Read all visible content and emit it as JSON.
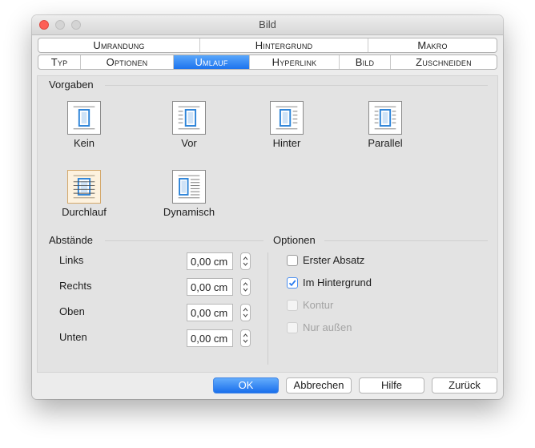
{
  "window": {
    "title": "Bild"
  },
  "tabs": {
    "row1": [
      "Umrandung",
      "Hintergrund",
      "Makro"
    ],
    "row2": [
      "Typ",
      "Optionen",
      "Umlauf",
      "Hyperlink",
      "Bild",
      "Zuschneiden"
    ],
    "active": "Umlauf"
  },
  "vorgaben": {
    "title": "Vorgaben",
    "items": [
      {
        "label": "Kein",
        "icon": "wrap-none-icon",
        "selected": false
      },
      {
        "label": "Vor",
        "icon": "wrap-before-icon",
        "selected": false
      },
      {
        "label": "Hinter",
        "icon": "wrap-after-icon",
        "selected": false
      },
      {
        "label": "Parallel",
        "icon": "wrap-parallel-icon",
        "selected": false
      },
      {
        "label": "Durchlauf",
        "icon": "wrap-through-icon",
        "selected": true
      },
      {
        "label": "Dynamisch",
        "icon": "wrap-optimal-icon",
        "selected": false
      }
    ]
  },
  "abstaende": {
    "title": "Abstände",
    "rows": [
      {
        "label": "Links",
        "value": "0,00 cm"
      },
      {
        "label": "Rechts",
        "value": "0,00 cm"
      },
      {
        "label": "Oben",
        "value": "0,00 cm"
      },
      {
        "label": "Unten",
        "value": "0,00 cm"
      }
    ]
  },
  "optionen": {
    "title": "Optionen",
    "items": [
      {
        "label": "Erster Absatz",
        "checked": false,
        "enabled": true
      },
      {
        "label": "Im Hintergrund",
        "checked": true,
        "enabled": true
      },
      {
        "label": "Kontur",
        "checked": false,
        "enabled": false
      },
      {
        "label": "Nur außen",
        "checked": false,
        "enabled": false
      }
    ]
  },
  "buttons": {
    "ok": "OK",
    "cancel": "Abbrechen",
    "help": "Hilfe",
    "reset": "Zurück"
  },
  "colors": {
    "accent": "#2a7cf0",
    "selected_icon_bg": "#fdf2df",
    "page_blue": "#2b83d8"
  }
}
